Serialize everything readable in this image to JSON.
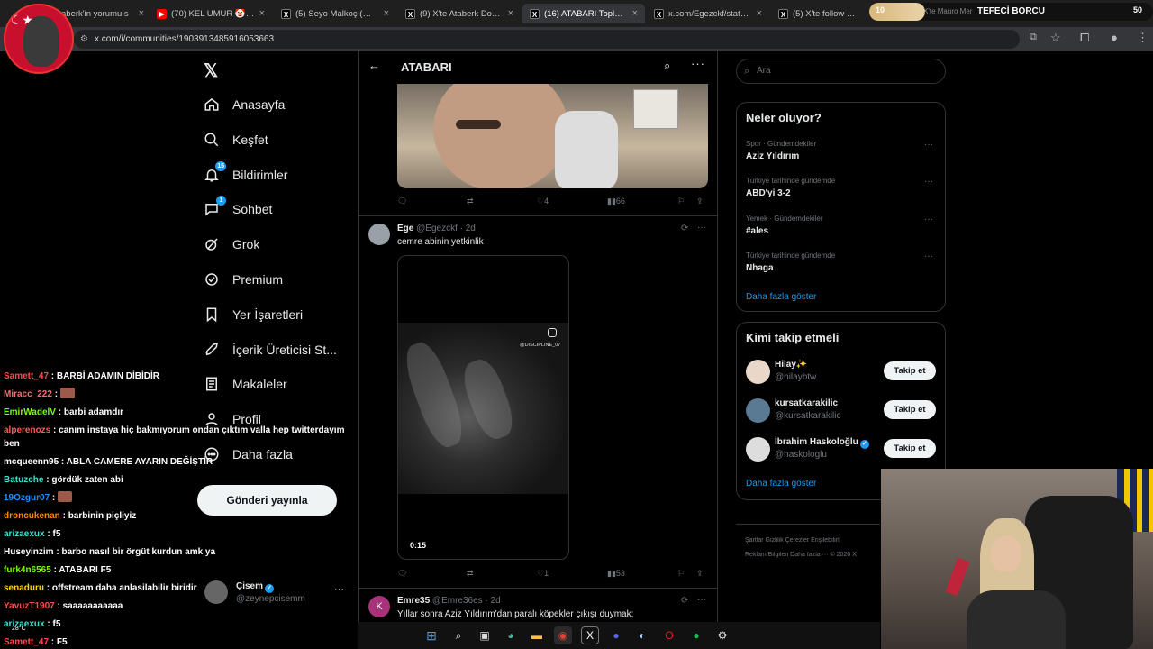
{
  "browser": {
    "tabs": [
      {
        "title": "aberk'in yorumu s",
        "icon": "x-icon"
      },
      {
        "title": "(70) KEL UMUR 🤡 #atab",
        "icon": "youtube-icon"
      },
      {
        "title": "(5) Seyo Malkoç (@seyoo",
        "icon": "x-icon"
      },
      {
        "title": "(9) X'te Ataberk Doğan: \"",
        "icon": "x-icon"
      },
      {
        "title": "(16) ATABARI Topluluk / X",
        "icon": "x-icon"
      },
      {
        "title": "x.com/Egezckf/status/20",
        "icon": "x-icon"
      },
      {
        "title": "(5) X'te follow @joshuax",
        "icon": "x-icon"
      },
      {
        "title": "X'te Mauro Mer",
        "icon": "x-icon"
      }
    ],
    "url": "x.com/i/communities/1903913485916053663"
  },
  "stream_overlay": {
    "left_value": "10",
    "title": "TEFECİ BORCU",
    "right_value": "50"
  },
  "nav": {
    "items": [
      {
        "label": "Anasayfa",
        "icon": "home-icon"
      },
      {
        "label": "Keşfet",
        "icon": "search-icon"
      },
      {
        "label": "Bildirimler",
        "icon": "bell-icon",
        "badge": "15"
      },
      {
        "label": "Sohbet",
        "icon": "chat-icon",
        "badge": "1"
      },
      {
        "label": "Grok",
        "icon": "grok-icon"
      },
      {
        "label": "Premium",
        "icon": "premium-icon"
      },
      {
        "label": "Yer İşaretleri",
        "icon": "bookmark-icon"
      },
      {
        "label": "İçerik Üreticisi St...",
        "icon": "rocket-icon"
      },
      {
        "label": "Makaleler",
        "icon": "article-icon"
      },
      {
        "label": "Profil",
        "icon": "profile-icon"
      },
      {
        "label": "Daha fazla",
        "icon": "more-icon"
      }
    ],
    "post_button": "Gönderi yayınla",
    "account": {
      "name": "Çisem",
      "handle": "@zeynepcisemm"
    }
  },
  "community": {
    "title": "ATABARI",
    "tweet1_actions": {
      "likes": "4",
      "views": "66"
    },
    "tweet2": {
      "name": "Ege",
      "handle": "@Egezckf",
      "time": "2d",
      "text": "cemre abinin yetkinlik",
      "video_watermark": "@DISCIPLINE_07",
      "video_time": "0:15",
      "likes": "1",
      "views": "53"
    },
    "tweet3": {
      "avatar_letter": "K",
      "name": "Emre35",
      "handle": "@Emre36es",
      "time": "2d",
      "text": "Yıllar sonra Aziz Yıldırım'dan paralı köpekler çıkışı duymak:"
    }
  },
  "right": {
    "search_placeholder": "Ara",
    "trends_title": "Neler oluyor?",
    "trends": [
      {
        "category": "Spor · Gündemdekiler",
        "name": "Aziz Yıldırım"
      },
      {
        "category": "Türkiye tarihinde gündemde",
        "name": "ABD'yi 3-2"
      },
      {
        "category": "Yemek · Gündemdekiler",
        "name": "#ales"
      },
      {
        "category": "Türkiye tarihinde gündemde",
        "name": "Nhaga"
      }
    ],
    "show_more": "Daha fazla göster",
    "who_title": "Kimi takip etmeli",
    "who": [
      {
        "name": "Hilay✨",
        "handle": "@hilaybtw",
        "button": "Takip et"
      },
      {
        "name": "kursatkarakilic",
        "handle": "@kursatkarakilic",
        "button": "Takip et"
      },
      {
        "name": "İbrahim Haskoloğlu",
        "handle": "@haskologlu",
        "button": "Takip et"
      }
    ],
    "who_show_more": "Daha fazla göster",
    "footer_line1": "Şartlar   Gizlilik   Çerezler   Erişilebilirl",
    "footer_line2": "Reklam Bilgileri   Daha fazla ···   © 2026 X"
  },
  "chat": [
    {
      "user": "Samett_47",
      "color": "#ff4a4a",
      "msg": "BARBİ ADAMIN DİBİDİR"
    },
    {
      "user": "Miracc_222",
      "color": "#ff6b6b",
      "msg": "",
      "emote": true
    },
    {
      "user": "EmirWadelV",
      "color": "#7cfc00",
      "msg": "barbi adamdır"
    },
    {
      "user": "alperenozs",
      "color": "#ff5a5a",
      "msg": "canım instaya hiç bakmıyorum ondan çıktım valla hep twitterdayım ben"
    },
    {
      "user": "mcqueenn95",
      "color": "#ffffff",
      "msg": "ABLA CAMERE AYARIN DEĞİŞTİR"
    },
    {
      "user": "Batuzche",
      "color": "#40e0d0",
      "msg": "gördük zaten abi"
    },
    {
      "user": "19Ozgur07",
      "color": "#1e90ff",
      "msg": "",
      "emote": true
    },
    {
      "user": "droncukenan",
      "color": "#ff8c00",
      "msg": "barbinin piçliyiz"
    },
    {
      "user": "arizaexux",
      "color": "#40e0d0",
      "msg": "f5"
    },
    {
      "user": "Huseyinzim",
      "color": "#ffffff",
      "msg": "barbo nasıl bir örgüt kurdun amk ya"
    },
    {
      "user": "furk4n6565",
      "color": "#7cfc00",
      "msg": "ATABARI F5"
    },
    {
      "user": "senaduru",
      "color": "#ffd700",
      "msg": "offstream daha anlasilabilir biridir"
    },
    {
      "user": "YavuzT1907",
      "color": "#ff4a4a",
      "msg": "saaaaaaaaaaa"
    },
    {
      "user": "arizaexux",
      "color": "#40e0d0",
      "msg": "f5"
    },
    {
      "user": "Samett_47",
      "color": "#ff4a4a",
      "msg": "F5"
    }
  ],
  "weather": "28°C",
  "colors": {
    "accent": "#1d9bf0",
    "bg": "#000000",
    "border": "#2f3336",
    "muted": "#71767b"
  }
}
